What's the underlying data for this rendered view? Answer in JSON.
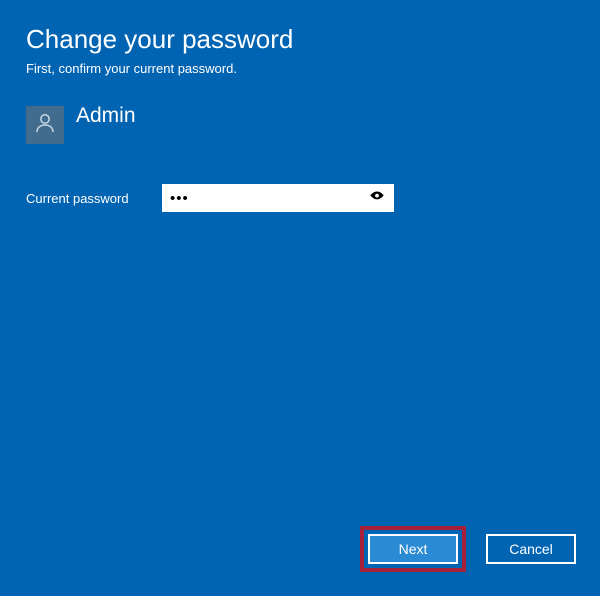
{
  "title": "Change your password",
  "subtitle": "First, confirm your current password.",
  "user": {
    "name": "Admin"
  },
  "field": {
    "label": "Current password",
    "value": "•••"
  },
  "buttons": {
    "next": "Next",
    "cancel": "Cancel"
  }
}
